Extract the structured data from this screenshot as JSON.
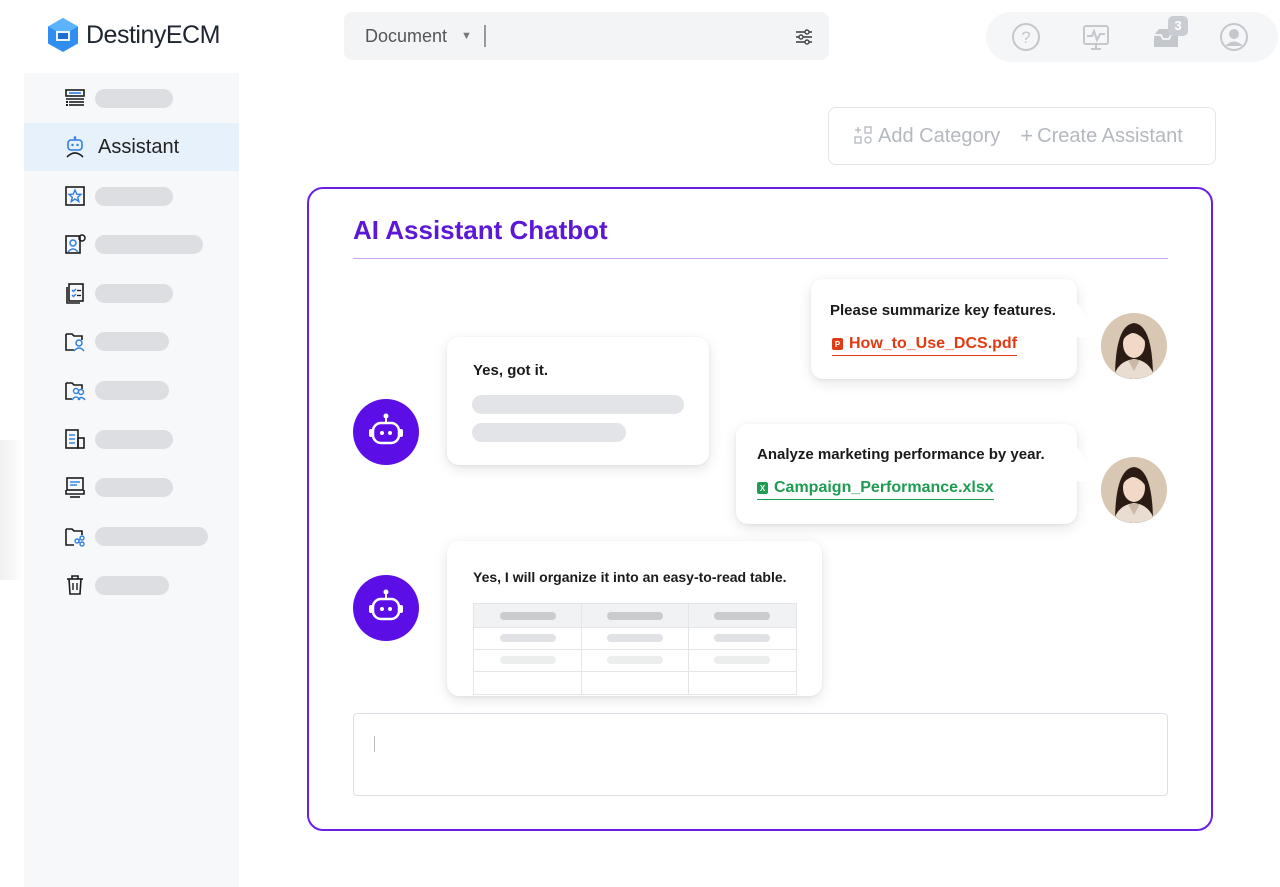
{
  "brand": {
    "name": "DestinyECM",
    "accent": "#2f6fde"
  },
  "search": {
    "type_label": "Document",
    "placeholder": ""
  },
  "top_actions": {
    "notification_count": "3"
  },
  "sidebar": {
    "active_label": "Assistant",
    "items": [
      "list-icon",
      "assistant-icon",
      "star-icon",
      "user-settings-icon",
      "checklist-icon",
      "folder-user-icon",
      "folder-group-icon",
      "building-doc-icon",
      "tray-doc-icon",
      "folder-share-icon",
      "trash-icon"
    ]
  },
  "actions": {
    "add_category": "Add Category",
    "create_assistant": "Create Assistant"
  },
  "chat": {
    "title": "AI Assistant Chatbot",
    "accent": "#5b18d6",
    "messages": [
      {
        "role": "user",
        "text": "Please summarize key features.",
        "attachment": "How_to_Use_DCS.pdf",
        "attachment_type": "pdf"
      },
      {
        "role": "assistant",
        "text": "Yes, got it."
      },
      {
        "role": "user",
        "text": "Analyze marketing performance by year.",
        "attachment": "Campaign_Performance.xlsx",
        "attachment_type": "xlsx"
      },
      {
        "role": "assistant",
        "text": "Yes, I will organize it into an easy-to-read table."
      }
    ],
    "input_placeholder": ""
  }
}
